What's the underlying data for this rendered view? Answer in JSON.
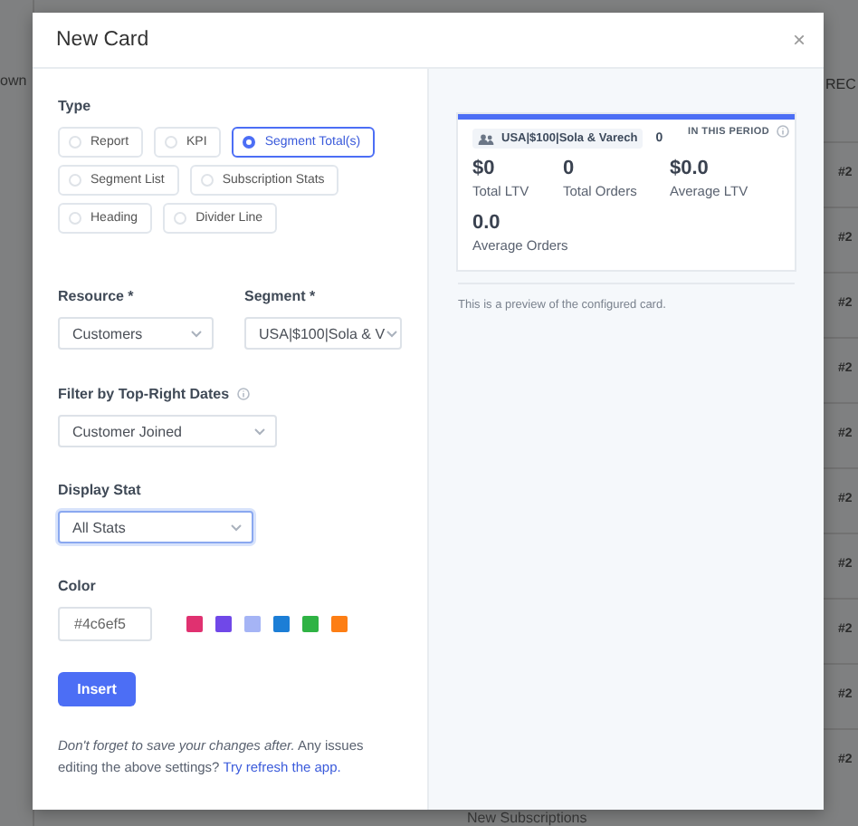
{
  "background": {
    "left_text": "own",
    "right_heading": "REC",
    "rows": [
      "#2",
      "#2",
      "#2",
      "#2",
      "#2",
      "#2",
      "#2",
      "#2",
      "#2",
      "#2"
    ],
    "bottom_text": "New Subscriptions"
  },
  "dialog": {
    "title": "New Card",
    "close": "×",
    "type": {
      "label": "Type",
      "options": [
        {
          "label": "Report",
          "selected": false
        },
        {
          "label": "KPI",
          "selected": false
        },
        {
          "label": "Segment Total(s)",
          "selected": true
        },
        {
          "label": "Segment List",
          "selected": false
        },
        {
          "label": "Subscription Stats",
          "selected": false
        },
        {
          "label": "Heading",
          "selected": false
        },
        {
          "label": "Divider Line",
          "selected": false
        }
      ]
    },
    "resource": {
      "label": "Resource *",
      "value": "Customers"
    },
    "segment": {
      "label": "Segment *",
      "value": "USA|$100|Sola & V"
    },
    "filter": {
      "label": "Filter by Top-Right Dates",
      "value": "Customer Joined"
    },
    "display_stat": {
      "label": "Display Stat",
      "value": "All Stats",
      "focused": true
    },
    "color": {
      "label": "Color",
      "value": "#4c6ef5",
      "swatches": [
        {
          "color": "#e03170"
        },
        {
          "color": "#7048e8"
        },
        {
          "color": "#a5b4f5"
        },
        {
          "color": "#1c7ed6"
        },
        {
          "color": "#2fb344"
        },
        {
          "color": "#fd7e14"
        }
      ]
    },
    "insert_button": "Insert",
    "note": "*Don't forget to save your changes after.* Any issues editing the above settings?",
    "note_link": "Try refresh the app."
  },
  "preview": {
    "segment_tag": "USA|$100|Sola & Varech",
    "tag_extra": "0",
    "period_badge": "IN THIS PERIOD",
    "stats": [
      {
        "value": "$0",
        "label": "Total LTV"
      },
      {
        "value": "0",
        "label": "Total Orders"
      },
      {
        "value": "$0.0",
        "label": "Average LTV"
      },
      {
        "value": "0.0",
        "label": "Average Orders"
      }
    ],
    "caption": "This is a preview of the configured card."
  }
}
